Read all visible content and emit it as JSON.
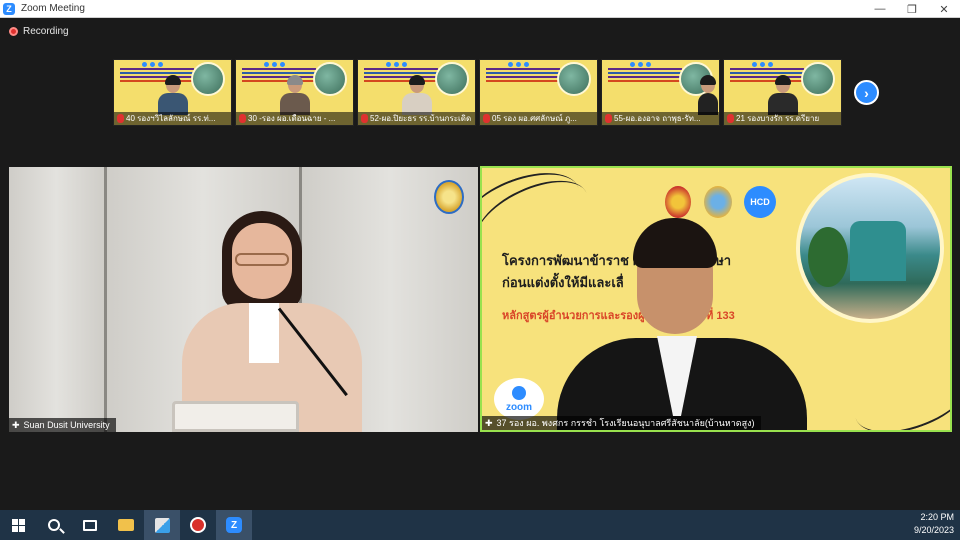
{
  "window": {
    "title": "Zoom Meeting",
    "app_icon_letter": "Z",
    "minimize": "—",
    "maximize": "❐",
    "close": "✕"
  },
  "recording": {
    "label": "Recording"
  },
  "gallery": {
    "thumbnails": [
      {
        "name": "40 รองฯวิไลลักษณ์ รร.ท่..."
      },
      {
        "name": "30 -รอง ผอ.เดือนฉาย - ..."
      },
      {
        "name": "52-ผอ.ปิยะธร รร.บ้านกระเดิด"
      },
      {
        "name": "05 รอง ผอ.ศศลักษณ์ ภู..."
      },
      {
        "name": "55-ผอ.องอาจ ถาพุธ-รัท..."
      },
      {
        "name": "21 รองบางรัก รร.ดรียาย"
      }
    ],
    "next_arrow": "›"
  },
  "main_videos": {
    "left": {
      "label": "Suan Dusit University"
    },
    "right": {
      "label": "37 รอง ผอ. พงศกร กรรชำ โรงเรียนอนุบาลศรีสัชนาลัย(บ้านหาดสูง)",
      "slide_title_line1": "โครงการพัฒนาข้าราช                            การทางการศึกษา",
      "slide_title_line2": "ก่อนแต่งตั้งให้มีและเลื่",
      "slide_subtitle": "หลักสูตรผู้อำนวยการและรองผู้                    รพิเศษ ระยะที่ 133",
      "hcd_logo": "HCD",
      "zoom_badge": "zoom"
    }
  },
  "taskbar": {
    "clock_time": "2:20 PM",
    "clock_date": "9/20/2023",
    "zoom_letter": "Z"
  },
  "colors": {
    "zoom_blue": "#2d8cff",
    "active_speaker_border": "#99e24e",
    "recording_red": "#e0312f",
    "taskbar": "#1f3346"
  }
}
